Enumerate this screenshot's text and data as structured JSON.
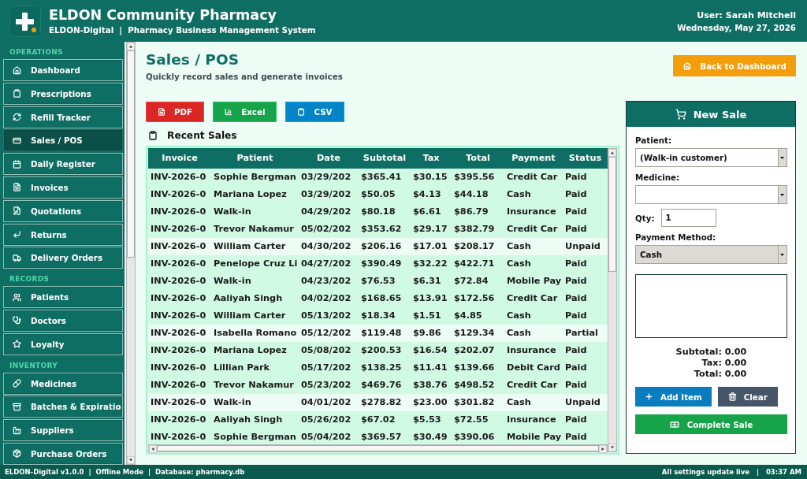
{
  "header": {
    "title": "ELDON Community Pharmacy",
    "subtitle": "ELDON-Digital  |  Pharmacy Business Management System",
    "user": "User: Sarah Mitchell",
    "date": "Wednesday, May 27, 2026"
  },
  "sidebar": {
    "sections": [
      {
        "label": "OPERATIONS",
        "items": [
          {
            "label": "Dashboard",
            "selected": false
          },
          {
            "label": "Prescriptions",
            "selected": false
          },
          {
            "label": "Refill Tracker",
            "selected": false
          },
          {
            "label": "Sales / POS",
            "selected": true
          },
          {
            "label": "Daily Register",
            "selected": false
          },
          {
            "label": "Invoices",
            "selected": false
          },
          {
            "label": "Quotations",
            "selected": false
          },
          {
            "label": "Returns",
            "selected": false
          },
          {
            "label": "Delivery Orders",
            "selected": false
          }
        ]
      },
      {
        "label": "RECORDS",
        "items": [
          {
            "label": "Patients",
            "selected": false
          },
          {
            "label": "Doctors",
            "selected": false
          },
          {
            "label": "Loyalty",
            "selected": false
          }
        ]
      },
      {
        "label": "INVENTORY",
        "items": [
          {
            "label": "Medicines",
            "selected": false
          },
          {
            "label": "Batches & Expiratio",
            "selected": false
          },
          {
            "label": "Suppliers",
            "selected": false
          },
          {
            "label": "Purchase Orders",
            "selected": false
          }
        ]
      }
    ]
  },
  "page": {
    "title": "Sales / POS",
    "subtitle": "Quickly record sales and generate invoices",
    "back_button": "Back to Dashboard"
  },
  "export_buttons": [
    {
      "label": "PDF",
      "kind": "pdf"
    },
    {
      "label": "Excel",
      "kind": "excel"
    },
    {
      "label": "CSV",
      "kind": "csv"
    }
  ],
  "recent_sales": {
    "title": "Recent Sales",
    "columns": [
      "Invoice",
      "Patient",
      "Date",
      "Subtotal",
      "Tax",
      "Total",
      "Payment",
      "Status"
    ],
    "rows": [
      {
        "cells": [
          "INV-2026-0",
          "Sophie Bergman",
          "03/29/202",
          "$365.41",
          "$30.15",
          "$395.56",
          "Credit Car",
          "Paid"
        ],
        "paid": true
      },
      {
        "cells": [
          "INV-2026-0",
          "Mariana Lopez",
          "03/29/202",
          "$50.05",
          "$4.13",
          "$44.18",
          "Cash",
          "Paid"
        ],
        "paid": true
      },
      {
        "cells": [
          "INV-2026-0",
          "Walk-in",
          "04/29/202",
          "$80.18",
          "$6.61",
          "$86.79",
          "Insurance",
          "Paid"
        ],
        "paid": true
      },
      {
        "cells": [
          "INV-2026-0",
          "Trevor Nakamur",
          "05/02/202",
          "$353.62",
          "$29.17",
          "$382.79",
          "Credit Car",
          "Paid"
        ],
        "paid": true
      },
      {
        "cells": [
          "INV-2026-0",
          "William Carter",
          "04/30/202",
          "$206.16",
          "$17.01",
          "$208.17",
          "Cash",
          "Unpaid"
        ],
        "paid": false
      },
      {
        "cells": [
          "INV-2026-0",
          "Penelope Cruz Li",
          "04/27/202",
          "$390.49",
          "$32.22",
          "$422.71",
          "Cash",
          "Paid"
        ],
        "paid": true
      },
      {
        "cells": [
          "INV-2026-0",
          "Walk-in",
          "04/23/202",
          "$76.53",
          "$6.31",
          "$72.84",
          "Mobile Pay",
          "Paid"
        ],
        "paid": true
      },
      {
        "cells": [
          "INV-2026-0",
          "Aaliyah Singh",
          "04/02/202",
          "$168.65",
          "$13.91",
          "$172.56",
          "Credit Car",
          "Paid"
        ],
        "paid": true
      },
      {
        "cells": [
          "INV-2026-0",
          "William Carter",
          "05/13/202",
          "$18.34",
          "$1.51",
          "$4.85",
          "Cash",
          "Paid"
        ],
        "paid": true
      },
      {
        "cells": [
          "INV-2026-0",
          "Isabella Romano",
          "05/12/202",
          "$119.48",
          "$9.86",
          "$129.34",
          "Cash",
          "Partial"
        ],
        "paid": false
      },
      {
        "cells": [
          "INV-2026-0",
          "Mariana Lopez",
          "05/08/202",
          "$200.53",
          "$16.54",
          "$202.07",
          "Insurance",
          "Paid"
        ],
        "paid": true
      },
      {
        "cells": [
          "INV-2026-0",
          "Lillian Park",
          "05/17/202",
          "$138.25",
          "$11.41",
          "$139.66",
          "Debit Card",
          "Paid"
        ],
        "paid": true
      },
      {
        "cells": [
          "INV-2026-0",
          "Trevor Nakamur",
          "05/23/202",
          "$469.76",
          "$38.76",
          "$498.52",
          "Credit Car",
          "Paid"
        ],
        "paid": true
      },
      {
        "cells": [
          "INV-2026-0",
          "Walk-in",
          "04/01/202",
          "$278.82",
          "$23.00",
          "$301.82",
          "Cash",
          "Unpaid"
        ],
        "paid": false
      },
      {
        "cells": [
          "INV-2026-0",
          "Aaliyah Singh",
          "05/26/202",
          "$67.02",
          "$5.53",
          "$72.55",
          "Insurance",
          "Paid"
        ],
        "paid": true
      },
      {
        "cells": [
          "INV-2026-0",
          "Sophie Bergman",
          "05/04/202",
          "$369.57",
          "$30.49",
          "$390.06",
          "Mobile Pay",
          "Paid"
        ],
        "paid": true
      }
    ]
  },
  "new_sale": {
    "title": "New Sale",
    "fields": [
      {
        "kind": "select",
        "label": "Patient:",
        "value": "(Walk-in customer)",
        "readonly": false
      },
      {
        "kind": "select",
        "label": "Medicine:",
        "readonly": false
      },
      {
        "kind": "number",
        "label": "Qty:",
        "value": "1"
      },
      {
        "kind": "select",
        "label": "Payment Method:",
        "value": "Cash",
        "readonly": true
      }
    ],
    "totals": [
      "Subtotal: 0.00",
      "Tax: 0.00",
      "Total: 0.00"
    ],
    "buttons": [
      {
        "label": "Add Item",
        "kind": "add"
      },
      {
        "label": "Clear",
        "kind": "clear"
      }
    ],
    "complete_button": "Complete Sale"
  },
  "status_bar": {
    "left": "ELDON-Digital v1.0.0  |  Offline Mode  |  Database: pharmacy.db",
    "right": "All settings update live   |   03:37 AM"
  }
}
